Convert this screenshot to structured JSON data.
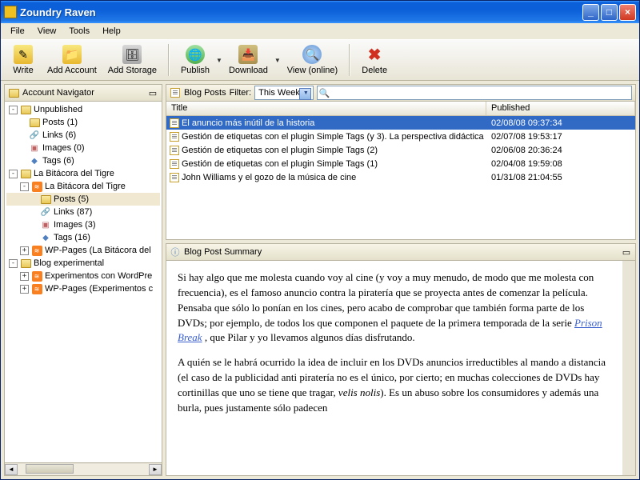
{
  "window": {
    "title": "Zoundry Raven"
  },
  "menu": {
    "file": "File",
    "view": "View",
    "tools": "Tools",
    "help": "Help"
  },
  "toolbar": {
    "write": "Write",
    "add_account": "Add Account",
    "add_storage": "Add Storage",
    "publish": "Publish",
    "download": "Download",
    "view_online": "View (online)",
    "delete": "Delete"
  },
  "navigator": {
    "title": "Account Navigator",
    "unpublished": "Unpublished",
    "posts1": "Posts (1)",
    "links6": "Links (6)",
    "images0": "Images (0)",
    "tags6": "Tags (6)",
    "acct1": "La Bitácora del Tigre",
    "blog1": "La Bitácora del Tigre",
    "posts5": "Posts (5)",
    "links87": "Links (87)",
    "images3": "Images (3)",
    "tags16": "Tags (16)",
    "wp1": "WP-Pages (La Bitácora del",
    "acct2": "Blog experimental",
    "blog2a": "Experimentos con WordPre",
    "blog2b": "WP-Pages (Experimentos c"
  },
  "posts": {
    "title": "Blog Posts",
    "filter_label": "Filter:",
    "filter_value": "This Week",
    "cols": {
      "title": "Title",
      "published": "Published"
    },
    "rows": [
      {
        "title": "El anuncio más inútil de la historia",
        "pub": "02/08/08 09:37:34"
      },
      {
        "title": "Gestión de etiquetas con el plugin Simple Tags (y 3). La perspectiva didáctica",
        "pub": "02/07/08 19:53:17"
      },
      {
        "title": "Gestión de etiquetas con el plugin Simple Tags (2)",
        "pub": "02/06/08 20:36:24"
      },
      {
        "title": "Gestión de etiquetas con el plugin Simple Tags (1)",
        "pub": "02/04/08 19:59:08"
      },
      {
        "title": "John Williams y el gozo de la música de cine",
        "pub": "01/31/08 21:04:55"
      }
    ]
  },
  "summary": {
    "title": "Blog Post Summary",
    "p1a": "Si hay algo que me molesta cuando voy al cine (y voy a muy menudo, de modo que me molesta con frecuencia), es el famoso anuncio contra la piratería que se proyecta antes de comenzar la película. Pensaba que sólo lo ponían en los cines, pero acabo de comprobar que también forma parte de los DVDs; por ejemplo, de todos los que componen el paquete de la primera temporada de la serie ",
    "p1_link": "Prison Break",
    "p1b": " , que Pilar y yo llevamos algunos días disfrutando.",
    "p2a": "A quién se le habrá ocurrido la idea de incluir en los DVDs anuncios irreductibles al mando a distancia (el caso de la publicidad anti piratería no es el único, por cierto; en muchas colecciones de DVDs hay cortinillas que uno se tiene que tragar, ",
    "p2_em": "velis nolis",
    "p2b": "). Es un abuso sobre los consumidores y además una burla, pues justamente sólo padecen"
  }
}
